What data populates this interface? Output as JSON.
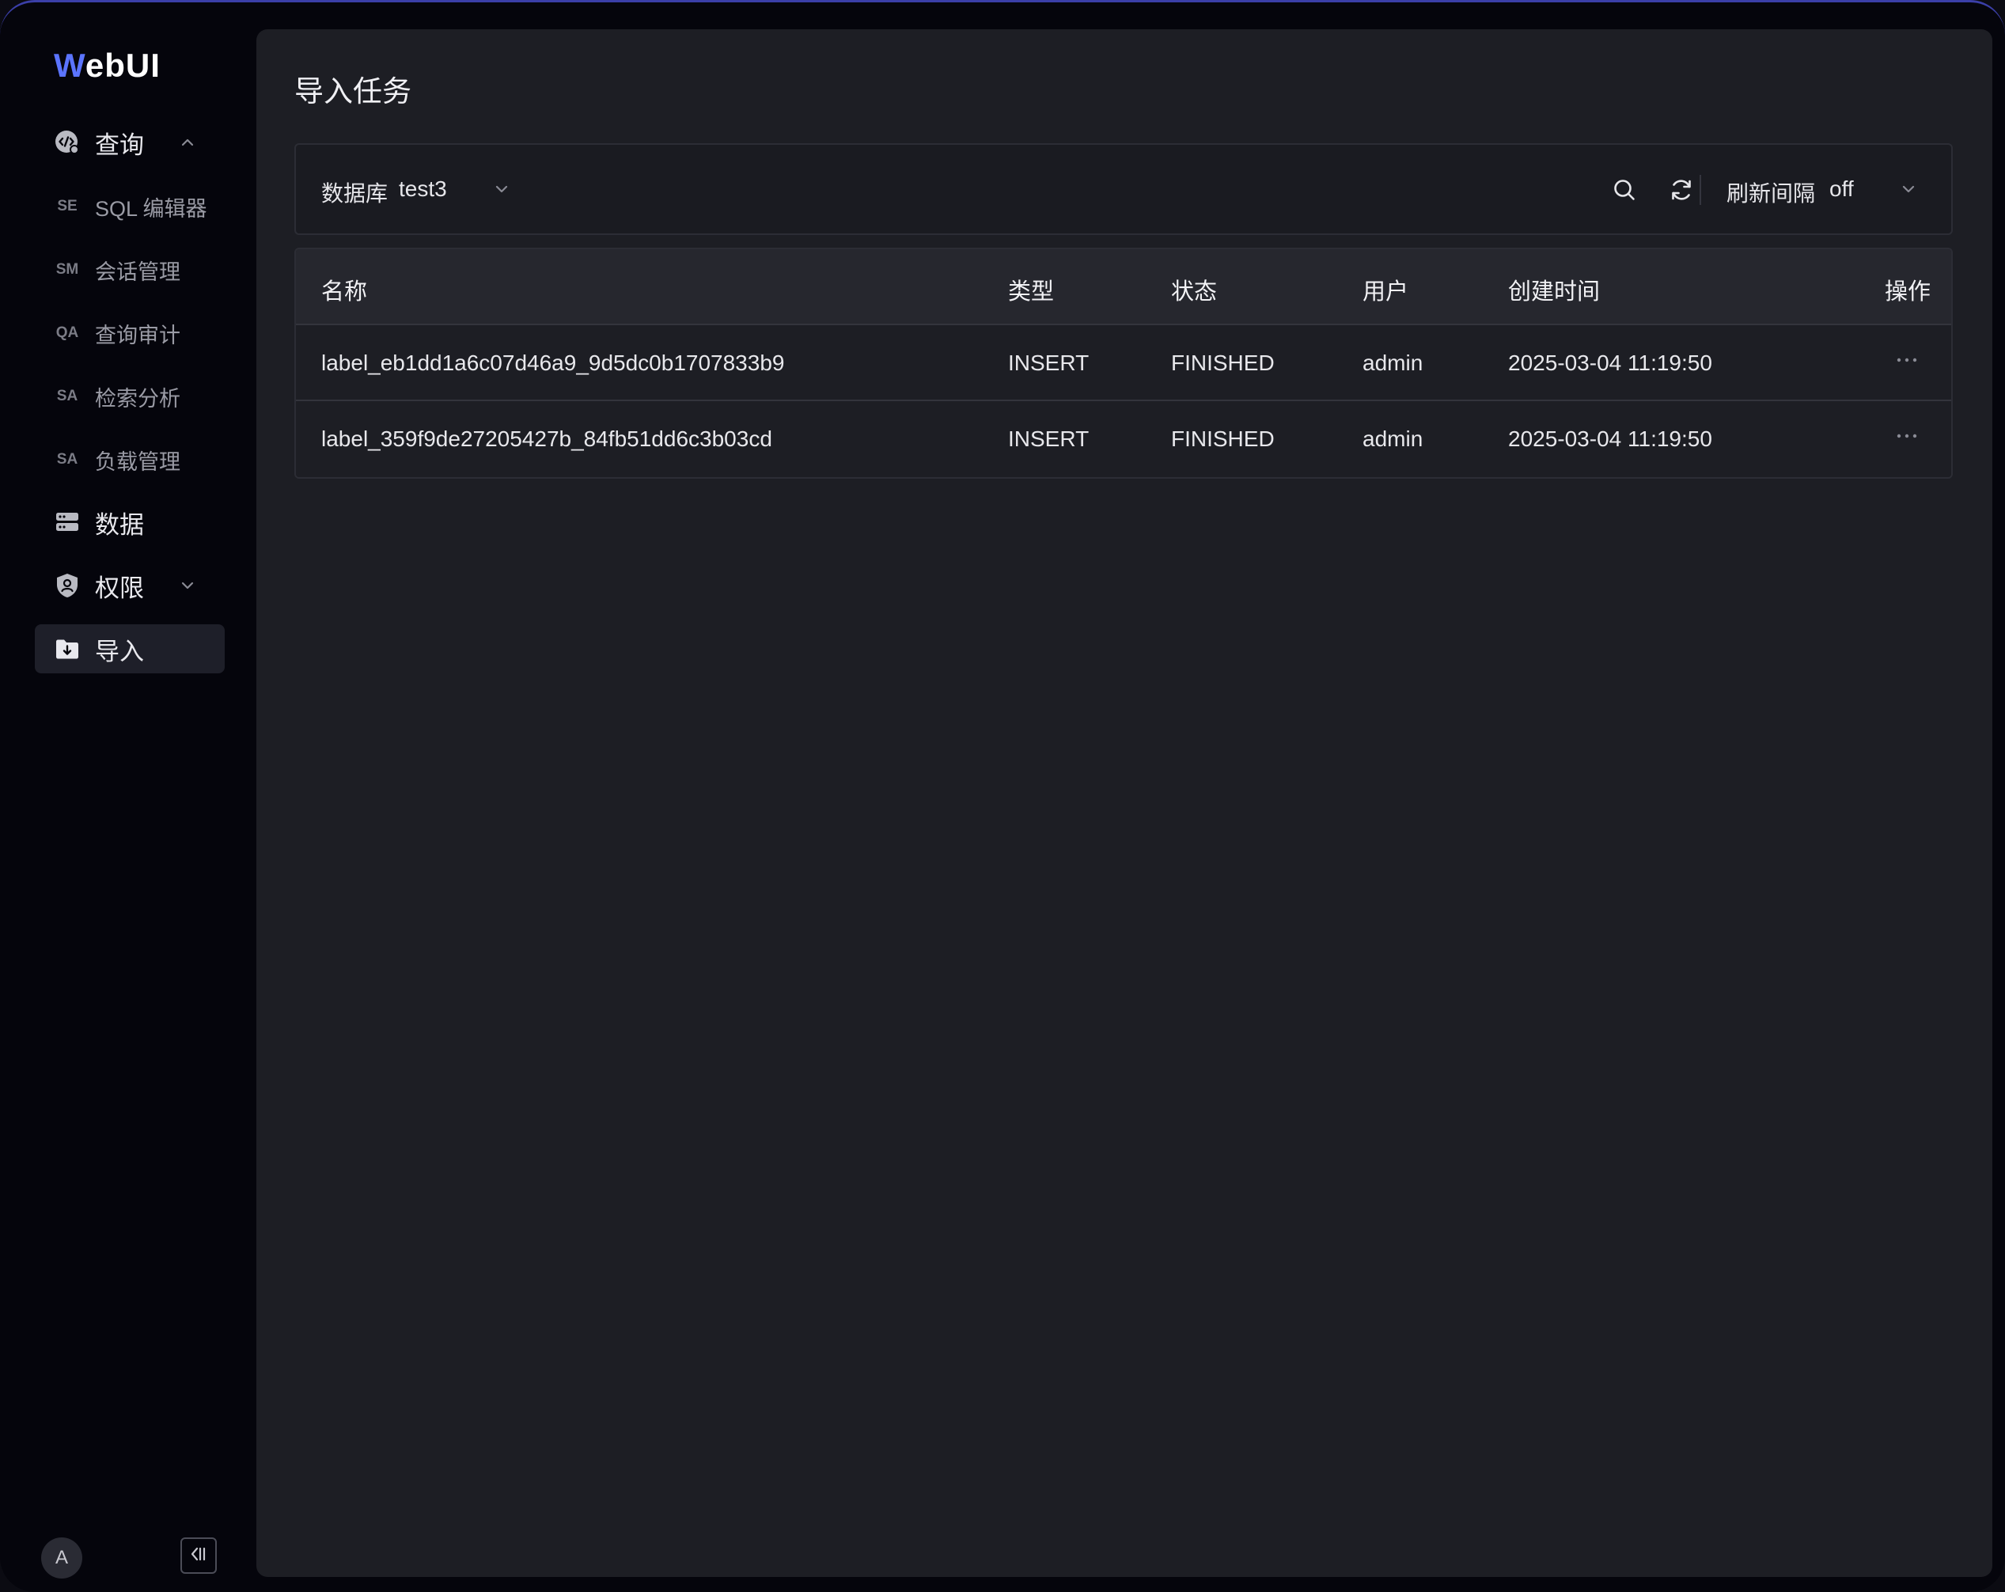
{
  "app": {
    "logo_first": "W",
    "logo_rest": "ebUI"
  },
  "sidebar": {
    "query": {
      "label": "查询"
    },
    "sub_items": [
      {
        "abbr": "SE",
        "label": "SQL 编辑器"
      },
      {
        "abbr": "SM",
        "label": "会话管理"
      },
      {
        "abbr": "QA",
        "label": "查询审计"
      },
      {
        "abbr": "SA",
        "label": "检索分析"
      },
      {
        "abbr": "SA",
        "label": "负载管理"
      }
    ],
    "data": {
      "label": "数据"
    },
    "permissions": {
      "label": "权限"
    },
    "import": {
      "label": "导入"
    },
    "avatar_initial": "A"
  },
  "page": {
    "title": "导入任务"
  },
  "toolbar": {
    "db_label": "数据库",
    "db_value": "test3",
    "refresh_label": "刷新间隔",
    "refresh_value": "off"
  },
  "table": {
    "columns": [
      "名称",
      "类型",
      "状态",
      "用户",
      "创建时间",
      "操作"
    ],
    "rows": [
      {
        "name": "label_eb1dd1a6c07d46a9_9d5dc0b1707833b9",
        "type": "INSERT",
        "status": "FINISHED",
        "user": "admin",
        "created": "2025-03-04 11:19:50"
      },
      {
        "name": "label_359f9de27205427b_84fb51dd6c3b03cd",
        "type": "INSERT",
        "status": "FINISHED",
        "user": "admin",
        "created": "2025-03-04 11:19:50"
      }
    ]
  },
  "colors": {
    "accent": "#5b74ff",
    "background": "#05050c",
    "panel": "#1d1e24"
  }
}
